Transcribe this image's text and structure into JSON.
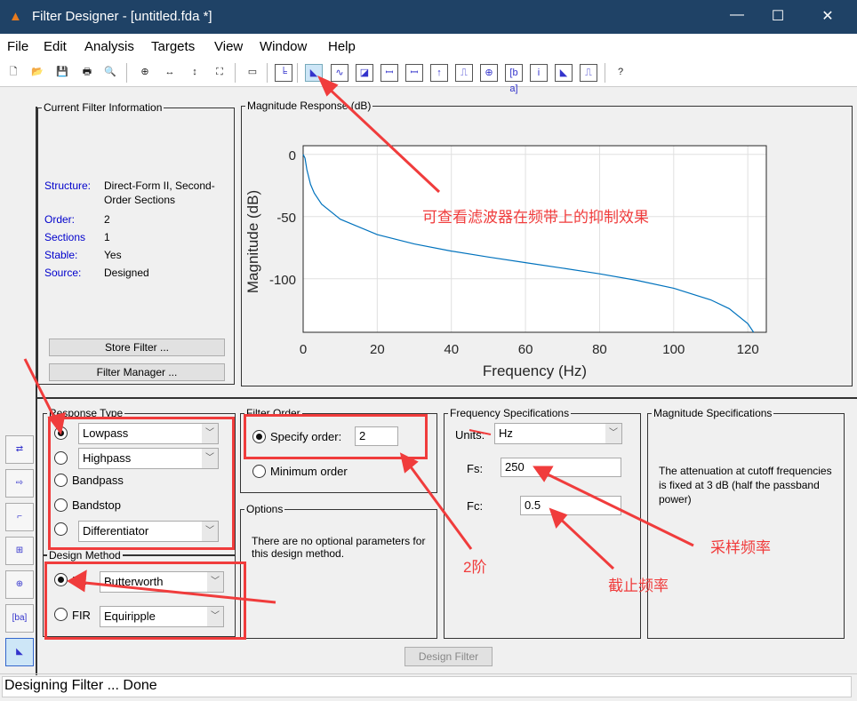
{
  "window": {
    "title": "Filter Designer -  [untitled.fda *]",
    "minimize": "—",
    "maximize": "☐",
    "close": "✕"
  },
  "menu": [
    "File",
    "Edit",
    "Analysis",
    "Targets",
    "View",
    "Window",
    "Help"
  ],
  "toolbar": {
    "icons": [
      "new-icon",
      "open-icon",
      "save-icon",
      "print-icon",
      "print-preview-icon",
      "zoom-in-icon",
      "zoom-x-icon",
      "zoom-y-icon",
      "full-view-icon",
      "new-figure-icon",
      "filter-specs-icon",
      "magnitude-response-icon",
      "phase-response-icon",
      "magnitude-phase-icon",
      "group-delay-icon",
      "phase-delay-icon",
      "impulse-response-icon",
      "step-response-icon",
      "pole-zero-icon",
      "coefficients-icon",
      "info-icon",
      "magnitude-estimate-icon",
      "noise-power-icon",
      "whats-this-icon"
    ],
    "glyphs": [
      "🗋",
      "📂",
      "💾",
      "🖶",
      "🔍",
      "⊕",
      "↔",
      "↕",
      "⛶",
      "▭",
      "╘",
      "◣",
      "∿",
      "◪",
      "ꟷ",
      "ꟷ",
      "↑",
      "⎍",
      "⊕",
      "[b a]",
      "i",
      "◣",
      "⎍",
      "?"
    ],
    "selected": 11
  },
  "info": {
    "title": "Current Filter Information",
    "rows": [
      {
        "k": "Structure:",
        "v": "Direct-Form II, Second-Order Sections"
      },
      {
        "k": "Order:",
        "v": "2"
      },
      {
        "k": "Sections",
        "v": "1"
      },
      {
        "k": "Stable:",
        "v": "Yes"
      },
      {
        "k": "Source:",
        "v": "Designed"
      }
    ],
    "store": "Store Filter ...",
    "manager": "Filter Manager ..."
  },
  "plot": {
    "panel_title": "Magnitude Response (dB)"
  },
  "chart_data": {
    "type": "line",
    "xlabel": "Frequency (Hz)",
    "ylabel": "Magnitude (dB)",
    "xlim": [
      0,
      125
    ],
    "ylim": [
      -143,
      7
    ],
    "xticks": [
      "0",
      "20",
      "40",
      "60",
      "80",
      "100",
      "120"
    ],
    "yticks": [
      "0",
      "-50",
      "-100"
    ],
    "grid": true,
    "color": "#0072bd",
    "x": [
      0,
      0.5,
      1,
      2,
      3,
      5,
      10,
      20,
      30,
      40,
      50,
      60,
      70,
      80,
      90,
      100,
      110,
      115,
      120,
      122
    ],
    "y": [
      0,
      -3,
      -12.3,
      -24.1,
      -31.1,
      -40,
      -52.1,
      -64.5,
      -72,
      -77.7,
      -82.5,
      -87,
      -91.4,
      -96,
      -101.2,
      -107.6,
      -116.9,
      -124,
      -136.1,
      -144.9
    ]
  },
  "response": {
    "title": "Response Type",
    "options": [
      "Lowpass",
      "Highpass",
      "Bandpass",
      "Bandstop",
      "Differentiator"
    ],
    "selected": 0
  },
  "method": {
    "title": "Design Method",
    "iir": "IIR",
    "iir_value": "Butterworth",
    "fir": "FIR",
    "fir_value": "Equiripple",
    "selected": "IIR"
  },
  "order": {
    "title": "Filter Order",
    "specify": "Specify order:",
    "value": "2",
    "minimum": "Minimum order"
  },
  "options": {
    "title": "Options",
    "text": "There are no optional parameters for this design method."
  },
  "freq": {
    "title": "Frequency Specifications",
    "units_label": "Units:",
    "units": "Hz",
    "fs_label": "Fs:",
    "fs": "250",
    "fc_label": "Fc:",
    "fc": "0.5"
  },
  "mag": {
    "title": "Magnitude Specifications",
    "text": "The attenuation at cutoff frequencies is fixed at 3 dB (half the passband power)"
  },
  "design_button": "Design Filter",
  "status": "Designing Filter ... Done",
  "annotations": {
    "plot": "可查看滤波器在频带上的抑制效果",
    "order": "2阶",
    "fs": "采样频率",
    "fc": "截止频率",
    "color": "#f03c3c"
  }
}
